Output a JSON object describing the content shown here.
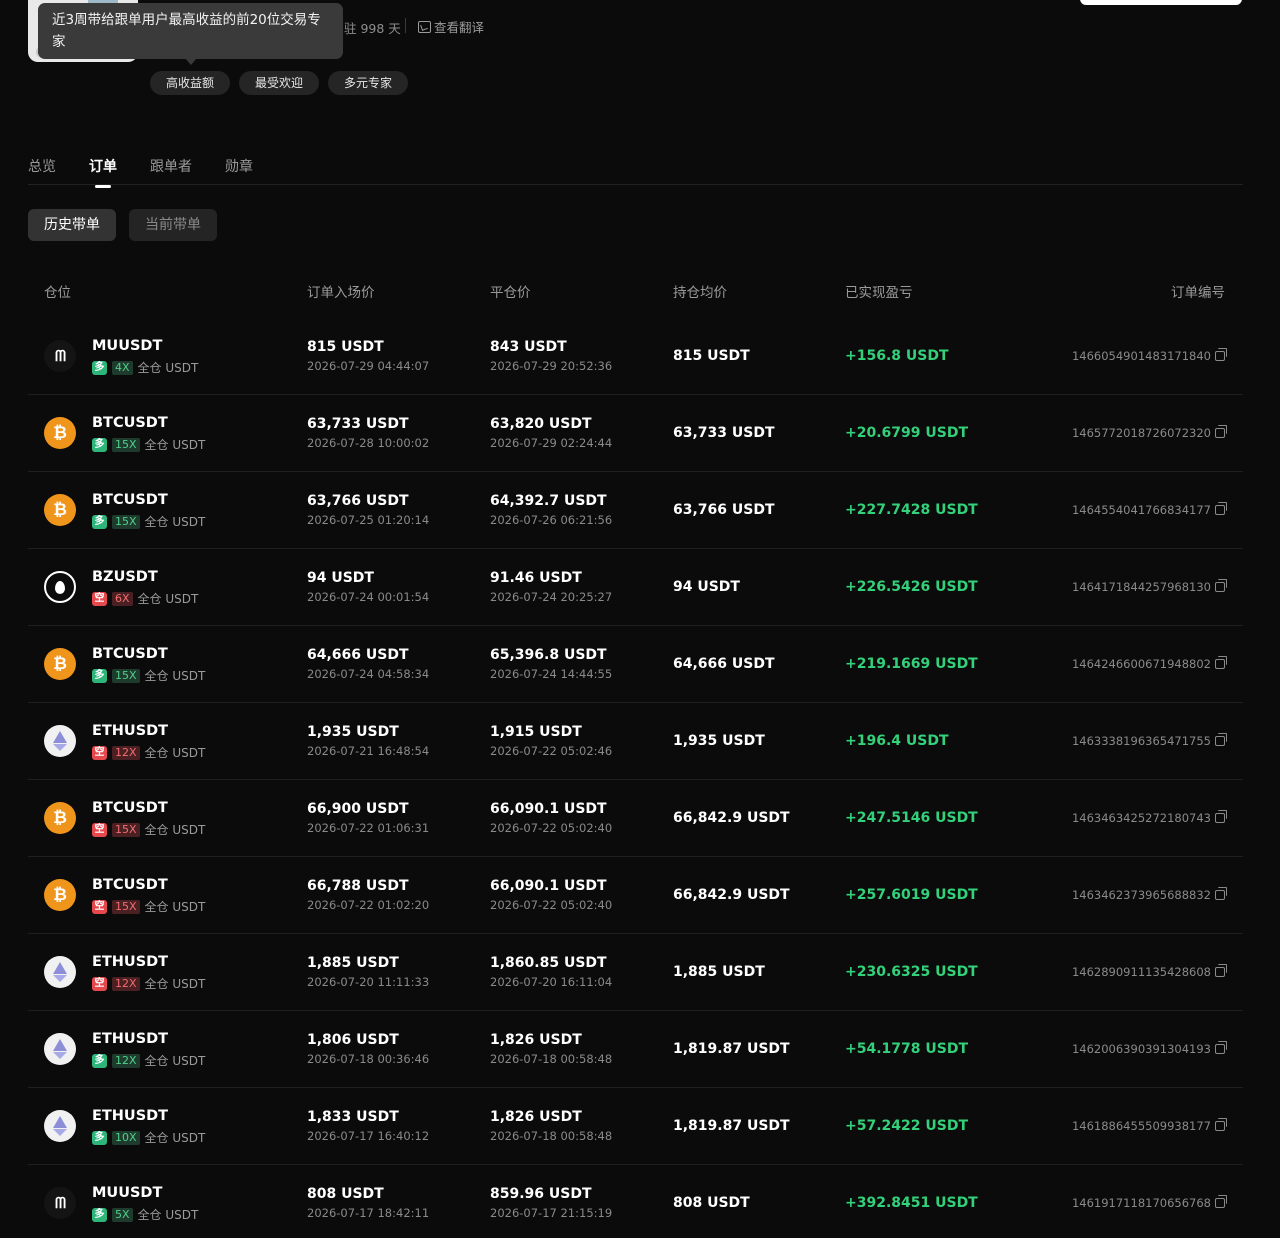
{
  "header": {
    "tooltip": "近3周带给跟单用户最高收益的前20位交易专家",
    "days": "驻 998 天",
    "translate_label": "查看翻译",
    "tags": [
      "高收益额",
      "最受欢迎",
      "多元专家"
    ]
  },
  "tabs": [
    "总览",
    "订单",
    "跟单者",
    "勋章"
  ],
  "active_tab": "订单",
  "subtabs": [
    "历史带单",
    "当前带单"
  ],
  "table": {
    "headers": {
      "position": "仓位",
      "entry": "订单入场价",
      "close": "平仓价",
      "avg": "持仓均价",
      "pnl": "已实现盈亏",
      "id": "订单编号"
    },
    "rows": [
      {
        "symbol": "MUUSDT",
        "icon": "mu-icon",
        "dir": "多",
        "side": "long",
        "lev": "4X",
        "margin": "全仓 USDT",
        "entry": "815 USDT",
        "entry_time": "2026-07-29 04:44:07",
        "close": "843 USDT",
        "close_time": "2026-07-29 20:52:36",
        "avg": "815 USDT",
        "pnl": "+156.8 USDT",
        "id": "1466054901483171840"
      },
      {
        "symbol": "BTCUSDT",
        "icon": "btc-icon",
        "dir": "多",
        "side": "long",
        "lev": "15X",
        "margin": "全仓 USDT",
        "entry": "63,733 USDT",
        "entry_time": "2026-07-28 10:00:02",
        "close": "63,820 USDT",
        "close_time": "2026-07-29 02:24:44",
        "avg": "63,733 USDT",
        "pnl": "+20.6799 USDT",
        "id": "1465772018726072320"
      },
      {
        "symbol": "BTCUSDT",
        "icon": "btc-icon",
        "dir": "多",
        "side": "long",
        "lev": "15X",
        "margin": "全仓 USDT",
        "entry": "63,766 USDT",
        "entry_time": "2026-07-25 01:20:14",
        "close": "64,392.7 USDT",
        "close_time": "2026-07-26 06:21:56",
        "avg": "63,766 USDT",
        "pnl": "+227.7428 USDT",
        "id": "1464554041766834177"
      },
      {
        "symbol": "BZUSDT",
        "icon": "bz-icon",
        "dir": "空",
        "side": "short",
        "lev": "6X",
        "margin": "全仓 USDT",
        "entry": "94 USDT",
        "entry_time": "2026-07-24 00:01:54",
        "close": "91.46 USDT",
        "close_time": "2026-07-24 20:25:27",
        "avg": "94 USDT",
        "pnl": "+226.5426 USDT",
        "id": "1464171844257968130"
      },
      {
        "symbol": "BTCUSDT",
        "icon": "btc-icon",
        "dir": "多",
        "side": "long",
        "lev": "15X",
        "margin": "全仓 USDT",
        "entry": "64,666 USDT",
        "entry_time": "2026-07-24 04:58:34",
        "close": "65,396.8 USDT",
        "close_time": "2026-07-24 14:44:55",
        "avg": "64,666 USDT",
        "pnl": "+219.1669 USDT",
        "id": "1464246600671948802"
      },
      {
        "symbol": "ETHUSDT",
        "icon": "eth-icon",
        "dir": "空",
        "side": "short",
        "lev": "12X",
        "margin": "全仓 USDT",
        "entry": "1,935 USDT",
        "entry_time": "2026-07-21 16:48:54",
        "close": "1,915 USDT",
        "close_time": "2026-07-22 05:02:46",
        "avg": "1,935 USDT",
        "pnl": "+196.4 USDT",
        "id": "1463338196365471755"
      },
      {
        "symbol": "BTCUSDT",
        "icon": "btc-icon",
        "dir": "空",
        "side": "short",
        "lev": "15X",
        "margin": "全仓 USDT",
        "entry": "66,900 USDT",
        "entry_time": "2026-07-22 01:06:31",
        "close": "66,090.1 USDT",
        "close_time": "2026-07-22 05:02:40",
        "avg": "66,842.9 USDT",
        "pnl": "+247.5146 USDT",
        "id": "1463463425272180743"
      },
      {
        "symbol": "BTCUSDT",
        "icon": "btc-icon",
        "dir": "空",
        "side": "short",
        "lev": "15X",
        "margin": "全仓 USDT",
        "entry": "66,788 USDT",
        "entry_time": "2026-07-22 01:02:20",
        "close": "66,090.1 USDT",
        "close_time": "2026-07-22 05:02:40",
        "avg": "66,842.9 USDT",
        "pnl": "+257.6019 USDT",
        "id": "1463462373965688832"
      },
      {
        "symbol": "ETHUSDT",
        "icon": "eth-icon",
        "dir": "空",
        "side": "short",
        "lev": "12X",
        "margin": "全仓 USDT",
        "entry": "1,885 USDT",
        "entry_time": "2026-07-20 11:11:33",
        "close": "1,860.85 USDT",
        "close_time": "2026-07-20 16:11:04",
        "avg": "1,885 USDT",
        "pnl": "+230.6325 USDT",
        "id": "1462890911135428608"
      },
      {
        "symbol": "ETHUSDT",
        "icon": "eth-icon",
        "dir": "多",
        "side": "long",
        "lev": "12X",
        "margin": "全仓 USDT",
        "entry": "1,806 USDT",
        "entry_time": "2026-07-18 00:36:46",
        "close": "1,826 USDT",
        "close_time": "2026-07-18 00:58:48",
        "avg": "1,819.87 USDT",
        "pnl": "+54.1778 USDT",
        "id": "1462006390391304193"
      },
      {
        "symbol": "ETHUSDT",
        "icon": "eth-icon",
        "dir": "多",
        "side": "long",
        "lev": "10X",
        "margin": "全仓 USDT",
        "entry": "1,833 USDT",
        "entry_time": "2026-07-17 16:40:12",
        "close": "1,826 USDT",
        "close_time": "2026-07-18 00:58:48",
        "avg": "1,819.87 USDT",
        "pnl": "+57.2422 USDT",
        "id": "1461886455509938177"
      },
      {
        "symbol": "MUUSDT",
        "icon": "mu-icon",
        "dir": "多",
        "side": "long",
        "lev": "5X",
        "margin": "全仓 USDT",
        "entry": "808 USDT",
        "entry_time": "2026-07-17 18:42:11",
        "close": "859.96 USDT",
        "close_time": "2026-07-17 21:15:19",
        "avg": "808 USDT",
        "pnl": "+392.8451 USDT",
        "id": "1461917118170656768"
      }
    ]
  }
}
